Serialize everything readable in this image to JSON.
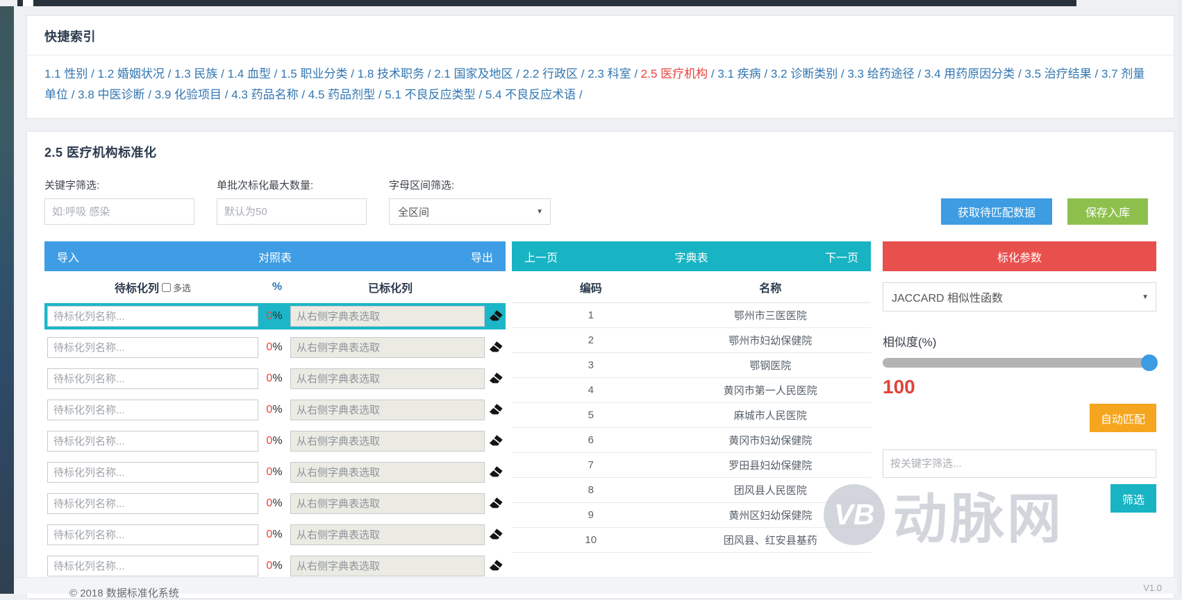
{
  "quick_index": {
    "title": "快捷索引",
    "separator": " / ",
    "links": [
      {
        "label": "1.1 性别",
        "active": false
      },
      {
        "label": "1.2 婚姻状况",
        "active": false
      },
      {
        "label": "1.3 民族",
        "active": false
      },
      {
        "label": "1.4 血型",
        "active": false
      },
      {
        "label": "1.5 职业分类",
        "active": false
      },
      {
        "label": "1.8 技术职务",
        "active": false
      },
      {
        "label": "2.1 国家及地区",
        "active": false
      },
      {
        "label": "2.2 行政区",
        "active": false
      },
      {
        "label": "2.3 科室",
        "active": false
      },
      {
        "label": "2.5 医疗机构",
        "active": true
      },
      {
        "label": "3.1 疾病",
        "active": false
      },
      {
        "label": "3.2 诊断类别",
        "active": false
      },
      {
        "label": "3.3 给药途径",
        "active": false
      },
      {
        "label": "3.4 用药原因分类",
        "active": false
      },
      {
        "label": "3.5 治疗结果",
        "active": false
      },
      {
        "label": "3.7 剂量单位",
        "active": false
      },
      {
        "label": "3.8 中医诊断",
        "active": false
      },
      {
        "label": "3.9 化验项目",
        "active": false
      },
      {
        "label": "4.3 药品名称",
        "active": false
      },
      {
        "label": "4.5 药品剂型",
        "active": false
      },
      {
        "label": "5.1 不良反应类型",
        "active": false
      },
      {
        "label": "5.4 不良反应术语",
        "active": false
      }
    ]
  },
  "standardize": {
    "title": "2.5 医疗机构标准化",
    "filters": {
      "keyword_label": "关键字筛选:",
      "keyword_placeholder": "如:呼吸 感染",
      "batch_label": "单批次标化最大数量:",
      "batch_placeholder": "默认为50",
      "letter_label": "字母区间筛选:",
      "letter_value": "全区间",
      "caret": "▼"
    },
    "fetch_button": "获取待匹配数据",
    "save_button": "保存入库",
    "mapping_panel": {
      "import_label": "导入",
      "title": "对照表",
      "export_label": "导出",
      "col_pending": "待标化列",
      "multi_select_label": "多选",
      "col_percent": "%",
      "col_done": "已标化列",
      "row_count": 9,
      "selected_row_index": 0,
      "row_placeholder": "待标化列名称...",
      "row_percent_value": "0",
      "row_percent_suffix": "%",
      "dict_placeholder": "从右侧字典表选取"
    },
    "dict_panel": {
      "prev_label": "上一页",
      "title": "字典表",
      "next_label": "下一页",
      "col_code": "编码",
      "col_name": "名称",
      "rows": [
        {
          "code": "1",
          "name": "鄂州市三医医院"
        },
        {
          "code": "2",
          "name": "鄂州市妇幼保健院"
        },
        {
          "code": "3",
          "name": "鄂钢医院"
        },
        {
          "code": "4",
          "name": "黄冈市第一人民医院"
        },
        {
          "code": "5",
          "name": "麻城市人民医院"
        },
        {
          "code": "6",
          "name": "黄冈市妇幼保健院"
        },
        {
          "code": "7",
          "name": "罗田县妇幼保健院"
        },
        {
          "code": "8",
          "name": "团风县人民医院"
        },
        {
          "code": "9",
          "name": "黄州区妇幼保健院"
        },
        {
          "code": "10",
          "name": "团风县、红安县基药"
        }
      ]
    },
    "params_panel": {
      "title": "标化参数",
      "function_value": "JACCARD 相似性函数",
      "caret": "▼",
      "similarity_label": "相似度(%)",
      "similarity_value": "100",
      "auto_match_button": "自动匹配",
      "filter_placeholder": "按关键字筛选...",
      "filter_button": "筛选"
    }
  },
  "footer": {
    "copyright": "© 2018 数据标准化系统",
    "version": "V1.0"
  },
  "watermark": {
    "logo": "VB",
    "text": "动脉网"
  },
  "colors": {
    "accent_blue": "#3d9ce2",
    "accent_teal": "#18b4c4",
    "accent_red": "#e8504d",
    "accent_green": "#8ec04e",
    "accent_orange": "#f6a61e",
    "link_blue": "#3276b1",
    "active_red": "#e8423c",
    "selected_row": "#1cb6c8"
  }
}
